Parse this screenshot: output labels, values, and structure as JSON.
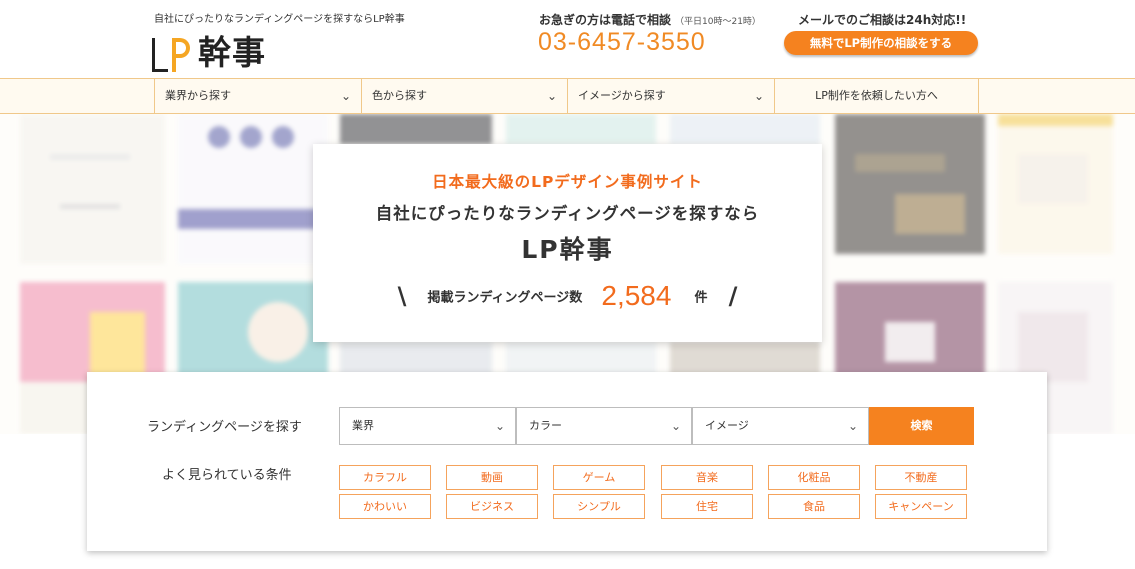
{
  "header": {
    "tagline": "自社にぴったりなランディングページを探すならLP幹事",
    "logo_text": "幹事",
    "phone_heading": "お急ぎの方は電話で相談",
    "phone_hours": "（平日10時～21時）",
    "phone_number": "03-6457-3550",
    "mail_heading": "メールでのご相談は24h対応!!",
    "mail_button": "無料でLP制作の相談をする"
  },
  "nav": {
    "items": [
      {
        "label": "業界から探す"
      },
      {
        "label": "色から探す"
      },
      {
        "label": "イメージから探す"
      },
      {
        "label": "LP制作を依頼したい方へ"
      }
    ]
  },
  "hero": {
    "line1": "日本最大級のLPデザイン事例サイト",
    "line2": "自社にぴったりなランディングページを探すなら",
    "line3": "LP幹事",
    "count_label": "掲載ランディングページ数",
    "count": "2,584",
    "count_unit": "件"
  },
  "search": {
    "label": "ランディングページを探す",
    "selects": [
      {
        "value": "業界"
      },
      {
        "value": "カラー"
      },
      {
        "value": "イメージ"
      }
    ],
    "button": "検索",
    "popular_label": "よく見られている条件",
    "tags": [
      "カラフル",
      "動画",
      "ゲーム",
      "音楽",
      "化粧品",
      "不動産",
      "かわいい",
      "ビジネス",
      "シンプル",
      "住宅",
      "食品",
      "キャンペーン"
    ]
  },
  "colors": {
    "accent": "#f5821f",
    "accent_text": "#f26b1d",
    "logo_p": "#f5a623"
  }
}
